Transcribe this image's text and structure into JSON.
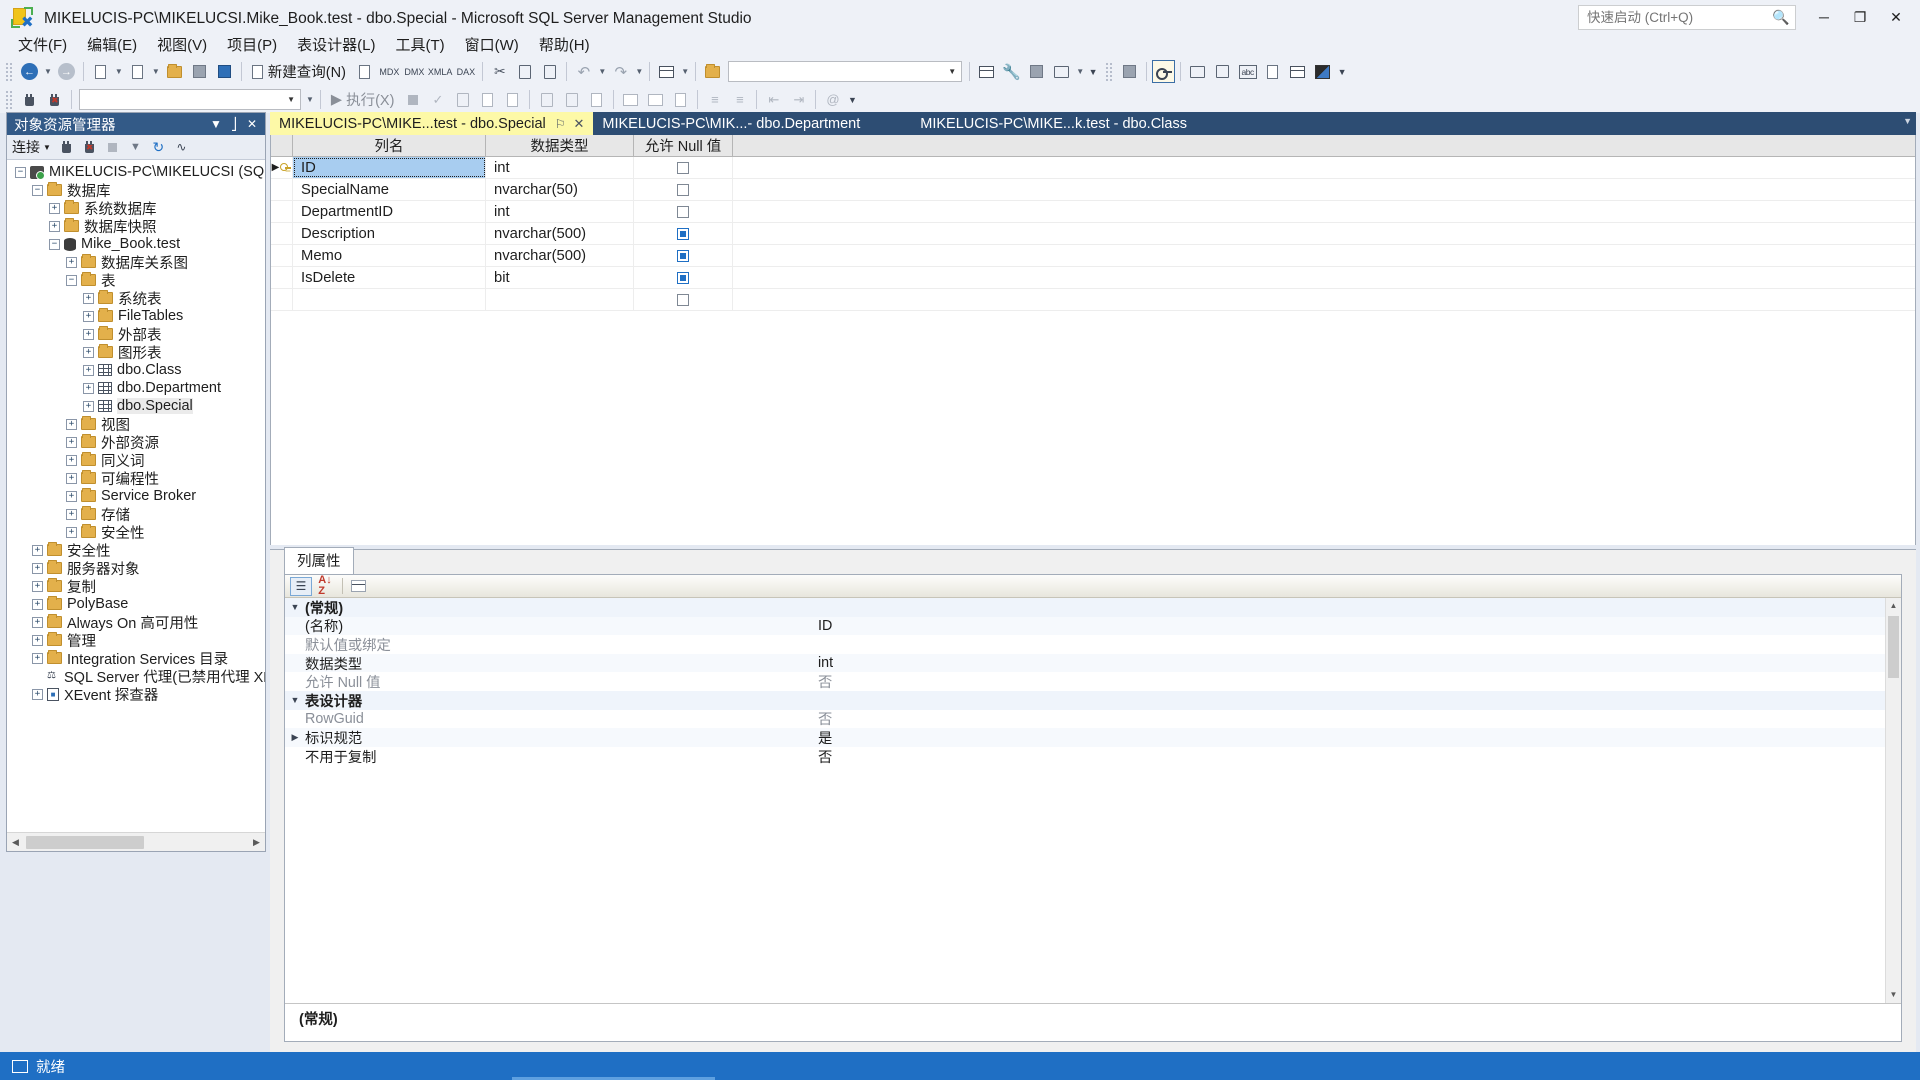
{
  "window": {
    "title": "MIKELUCIS-PC\\MIKELUCSI.Mike_Book.test - dbo.Special - Microsoft SQL Server Management Studio",
    "minimize_label": "─",
    "maximize_label": "❐",
    "close_label": "✕"
  },
  "quick_launch": {
    "placeholder": "快速启动 (Ctrl+Q)",
    "value": "",
    "icon": "search-icon"
  },
  "menu": {
    "items": [
      {
        "label": "文件(F)"
      },
      {
        "label": "编辑(E)"
      },
      {
        "label": "视图(V)"
      },
      {
        "label": "项目(P)"
      },
      {
        "label": "表设计器(L)"
      },
      {
        "label": "工具(T)"
      },
      {
        "label": "窗口(W)"
      },
      {
        "label": "帮助(H)"
      }
    ]
  },
  "toolbar": {
    "new_query_label": "新建查询(N)",
    "mdx_label": "MDX",
    "dmx_label": "DMX",
    "xmla_label": "XMLA",
    "dax_label": "DAX",
    "database_combo_value": "",
    "execute_label": "执行(X)",
    "overflow_label": "▾"
  },
  "object_explorer": {
    "title": "对象资源管理器",
    "connect_label": "连接",
    "tree": [
      {
        "label": "MIKELUCIS-PC\\MIKELUCSI (SQL Serv",
        "depth": 0,
        "expander": "−",
        "icon": "server-icon"
      },
      {
        "label": "数据库",
        "depth": 1,
        "expander": "−",
        "icon": "folder-icon"
      },
      {
        "label": "系统数据库",
        "depth": 2,
        "expander": "+",
        "icon": "folder-icon"
      },
      {
        "label": "数据库快照",
        "depth": 2,
        "expander": "+",
        "icon": "folder-icon"
      },
      {
        "label": "Mike_Book.test",
        "depth": 2,
        "expander": "−",
        "icon": "database-icon"
      },
      {
        "label": "数据库关系图",
        "depth": 3,
        "expander": "+",
        "icon": "folder-icon"
      },
      {
        "label": "表",
        "depth": 3,
        "expander": "−",
        "icon": "folder-icon"
      },
      {
        "label": "系统表",
        "depth": 4,
        "expander": "+",
        "icon": "folder-icon"
      },
      {
        "label": "FileTables",
        "depth": 4,
        "expander": "+",
        "icon": "folder-icon"
      },
      {
        "label": "外部表",
        "depth": 4,
        "expander": "+",
        "icon": "folder-icon"
      },
      {
        "label": "图形表",
        "depth": 4,
        "expander": "+",
        "icon": "folder-icon"
      },
      {
        "label": "dbo.Class",
        "depth": 4,
        "expander": "+",
        "icon": "table-icon"
      },
      {
        "label": "dbo.Department",
        "depth": 4,
        "expander": "+",
        "icon": "table-icon"
      },
      {
        "label": "dbo.Special",
        "depth": 4,
        "expander": "+",
        "icon": "table-icon",
        "selected": true
      },
      {
        "label": "视图",
        "depth": 3,
        "expander": "+",
        "icon": "folder-icon"
      },
      {
        "label": "外部资源",
        "depth": 3,
        "expander": "+",
        "icon": "folder-icon"
      },
      {
        "label": "同义词",
        "depth": 3,
        "expander": "+",
        "icon": "folder-icon"
      },
      {
        "label": "可编程性",
        "depth": 3,
        "expander": "+",
        "icon": "folder-icon"
      },
      {
        "label": "Service Broker",
        "depth": 3,
        "expander": "+",
        "icon": "folder-icon"
      },
      {
        "label": "存储",
        "depth": 3,
        "expander": "+",
        "icon": "folder-icon"
      },
      {
        "label": "安全性",
        "depth": 3,
        "expander": "+",
        "icon": "folder-icon"
      },
      {
        "label": "安全性",
        "depth": 1,
        "expander": "+",
        "icon": "folder-icon"
      },
      {
        "label": "服务器对象",
        "depth": 1,
        "expander": "+",
        "icon": "folder-icon"
      },
      {
        "label": "复制",
        "depth": 1,
        "expander": "+",
        "icon": "folder-icon"
      },
      {
        "label": "PolyBase",
        "depth": 1,
        "expander": "+",
        "icon": "folder-icon"
      },
      {
        "label": "Always On 高可用性",
        "depth": 1,
        "expander": "+",
        "icon": "folder-icon"
      },
      {
        "label": "管理",
        "depth": 1,
        "expander": "+",
        "icon": "folder-icon"
      },
      {
        "label": "Integration Services 目录",
        "depth": 1,
        "expander": "+",
        "icon": "folder-icon"
      },
      {
        "label": "SQL Server 代理(已禁用代理 XP)",
        "depth": 1,
        "expander": "",
        "icon": "sql-agent-icon"
      },
      {
        "label": "XEvent 探查器",
        "depth": 1,
        "expander": "+",
        "icon": "xevent-icon"
      }
    ]
  },
  "tabs": [
    {
      "label": "MIKELUCIS-PC\\MIKE...test - dbo.Special",
      "active": true,
      "pin": "⚐",
      "close": "✕"
    },
    {
      "label": "MIKELUCIS-PC\\MIK...- dbo.Department",
      "active": false
    },
    {
      "label": "MIKELUCIS-PC\\MIKE...k.test - dbo.Class",
      "active": false
    }
  ],
  "designer": {
    "columns": [
      "列名",
      "数据类型",
      "允许 Null 值"
    ],
    "rows": [
      {
        "name": "ID",
        "type": "int",
        "allow_null": false,
        "is_key": true,
        "selected": true
      },
      {
        "name": "SpecialName",
        "type": "nvarchar(50)",
        "allow_null": false
      },
      {
        "name": "DepartmentID",
        "type": "int",
        "allow_null": false
      },
      {
        "name": "Description",
        "type": "nvarchar(500)",
        "allow_null": true
      },
      {
        "name": "Memo",
        "type": "nvarchar(500)",
        "allow_null": true
      },
      {
        "name": "IsDelete",
        "type": "bit",
        "allow_null": true
      },
      {
        "name": "",
        "type": "",
        "allow_null": false
      }
    ]
  },
  "properties": {
    "tab_label": "列属性",
    "rows": [
      {
        "kind": "group",
        "name": "(常规)",
        "value": "",
        "tri": "▼"
      },
      {
        "kind": "item",
        "name": "(名称)",
        "value": "ID"
      },
      {
        "kind": "item",
        "name": "默认值或绑定",
        "value": "",
        "dim_name": true
      },
      {
        "kind": "item",
        "name": "数据类型",
        "value": "int"
      },
      {
        "kind": "item",
        "name": "允许 Null 值",
        "value": "否",
        "dim_name": true,
        "dim_value": true
      },
      {
        "kind": "group",
        "name": "表设计器",
        "value": "",
        "tri": "▼"
      },
      {
        "kind": "item",
        "name": "RowGuid",
        "value": "否",
        "dim_name": true,
        "dim_value": true
      },
      {
        "kind": "item",
        "name": "标识规范",
        "value": "是",
        "tri": "▶"
      },
      {
        "kind": "item",
        "name": "不用于复制",
        "value": "否"
      }
    ],
    "description_title": "(常规)"
  },
  "statusbar": {
    "text": "就绪"
  },
  "colors": {
    "accent": "#1f6fc4",
    "tab_active_bg": "#fdf9a7",
    "tabstrip_bg": "#2d4d73",
    "oe_title_bg": "#335a87",
    "selected_row": "#a8cdf0",
    "chrome_bg": "#eef1f7"
  }
}
